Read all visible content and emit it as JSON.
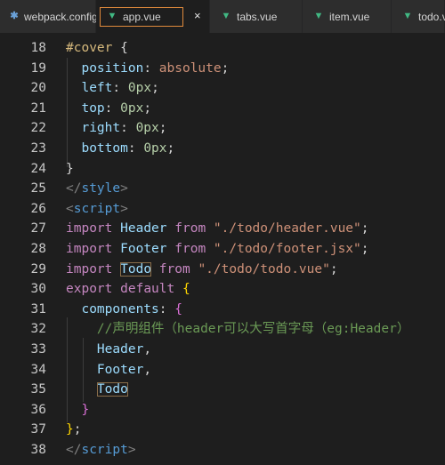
{
  "tabs": [
    {
      "label": "webpack.config.js",
      "icon": "gear-icon",
      "active": false
    },
    {
      "label": "app.vue",
      "icon": "vue-icon",
      "active": true,
      "close": "×"
    },
    {
      "label": "tabs.vue",
      "icon": "vue-icon",
      "active": false
    },
    {
      "label": "item.vue",
      "icon": "vue-icon",
      "active": false
    },
    {
      "label": "todo.vu",
      "icon": "vue-icon",
      "active": false
    }
  ],
  "icons": {
    "gear": "✱",
    "vue": "▼"
  },
  "colors": {
    "background": "#1e1e1e",
    "tab_bar": "#252526",
    "active_tab_border": "#e08a3c",
    "keyword": "#c586c0",
    "identifier": "#9cdcfe",
    "string": "#ce9178",
    "number": "#b5cea8",
    "comment": "#6a9955",
    "css_selector": "#d7ba7d",
    "tag": "#569cd6"
  },
  "editor": {
    "lines": [
      {
        "n": "18",
        "tokens": [
          {
            "t": "#cover",
            "c": "t-sel"
          },
          {
            "t": " ",
            "c": "t-plain"
          },
          {
            "t": "{",
            "c": "t-plain"
          }
        ]
      },
      {
        "n": "19",
        "tokens": [
          {
            "t": "  position",
            "c": "t-prop"
          },
          {
            "t": ": ",
            "c": "t-plain"
          },
          {
            "t": "absolute",
            "c": "t-val"
          },
          {
            "t": ";",
            "c": "t-plain"
          }
        ]
      },
      {
        "n": "20",
        "tokens": [
          {
            "t": "  left",
            "c": "t-prop"
          },
          {
            "t": ": ",
            "c": "t-plain"
          },
          {
            "t": "0px",
            "c": "t-num"
          },
          {
            "t": ";",
            "c": "t-plain"
          }
        ]
      },
      {
        "n": "21",
        "tokens": [
          {
            "t": "  top",
            "c": "t-prop"
          },
          {
            "t": ": ",
            "c": "t-plain"
          },
          {
            "t": "0px",
            "c": "t-num"
          },
          {
            "t": ";",
            "c": "t-plain"
          }
        ]
      },
      {
        "n": "22",
        "tokens": [
          {
            "t": "  right",
            "c": "t-prop"
          },
          {
            "t": ": ",
            "c": "t-plain"
          },
          {
            "t": "0px",
            "c": "t-num"
          },
          {
            "t": ";",
            "c": "t-plain"
          }
        ]
      },
      {
        "n": "23",
        "tokens": [
          {
            "t": "  bottom",
            "c": "t-prop"
          },
          {
            "t": ": ",
            "c": "t-plain"
          },
          {
            "t": "0px",
            "c": "t-num"
          },
          {
            "t": ";",
            "c": "t-plain"
          }
        ]
      },
      {
        "n": "24",
        "tokens": [
          {
            "t": "}",
            "c": "t-plain"
          }
        ]
      },
      {
        "n": "25",
        "tokens": [
          {
            "t": "</",
            "c": "t-tag"
          },
          {
            "t": "style",
            "c": "t-tagname"
          },
          {
            "t": ">",
            "c": "t-tag"
          }
        ]
      },
      {
        "n": "26",
        "tokens": [
          {
            "t": "<",
            "c": "t-tag"
          },
          {
            "t": "script",
            "c": "t-tagname"
          },
          {
            "t": ">",
            "c": "t-tag"
          }
        ]
      },
      {
        "n": "27",
        "tokens": [
          {
            "t": "import",
            "c": "t-kw"
          },
          {
            "t": " ",
            "c": "t-plain"
          },
          {
            "t": "Header",
            "c": "t-id"
          },
          {
            "t": " ",
            "c": "t-plain"
          },
          {
            "t": "from",
            "c": "t-kw"
          },
          {
            "t": " ",
            "c": "t-plain"
          },
          {
            "t": "\"./todo/header.vue\"",
            "c": "t-str"
          },
          {
            "t": ";",
            "c": "t-plain"
          }
        ]
      },
      {
        "n": "28",
        "tokens": [
          {
            "t": "import",
            "c": "t-kw"
          },
          {
            "t": " ",
            "c": "t-plain"
          },
          {
            "t": "Footer",
            "c": "t-id"
          },
          {
            "t": " ",
            "c": "t-plain"
          },
          {
            "t": "from",
            "c": "t-kw"
          },
          {
            "t": " ",
            "c": "t-plain"
          },
          {
            "t": "\"./todo/footer.jsx\"",
            "c": "t-str"
          },
          {
            "t": ";",
            "c": "t-plain"
          }
        ]
      },
      {
        "n": "29",
        "tokens": [
          {
            "t": "import",
            "c": "t-kw"
          },
          {
            "t": " ",
            "c": "t-plain"
          },
          {
            "t": "Todo",
            "c": "t-id hl"
          },
          {
            "t": " ",
            "c": "t-plain"
          },
          {
            "t": "from",
            "c": "t-kw"
          },
          {
            "t": " ",
            "c": "t-plain"
          },
          {
            "t": "\"./todo/todo.vue\"",
            "c": "t-str"
          },
          {
            "t": ";",
            "c": "t-plain"
          }
        ]
      },
      {
        "n": "30",
        "tokens": [
          {
            "t": "export",
            "c": "t-kw"
          },
          {
            "t": " ",
            "c": "t-plain"
          },
          {
            "t": "default",
            "c": "t-kw"
          },
          {
            "t": " ",
            "c": "t-plain"
          },
          {
            "t": "{",
            "c": "t-brace"
          }
        ]
      },
      {
        "n": "31",
        "tokens": [
          {
            "t": "  components",
            "c": "t-id"
          },
          {
            "t": ": ",
            "c": "t-plain"
          },
          {
            "t": "{",
            "c": "t-brace2"
          }
        ]
      },
      {
        "n": "32",
        "tokens": [
          {
            "t": "    //声明组件（header可以大写首字母（eg:Header）",
            "c": "t-cmt"
          }
        ]
      },
      {
        "n": "33",
        "tokens": [
          {
            "t": "    Header",
            "c": "t-id"
          },
          {
            "t": ",",
            "c": "t-plain"
          }
        ]
      },
      {
        "n": "34",
        "tokens": [
          {
            "t": "    Footer",
            "c": "t-id"
          },
          {
            "t": ",",
            "c": "t-plain"
          }
        ]
      },
      {
        "n": "35",
        "tokens": [
          {
            "t": "    ",
            "c": "t-plain"
          },
          {
            "t": "Todo",
            "c": "t-id hl"
          }
        ]
      },
      {
        "n": "36",
        "tokens": [
          {
            "t": "  }",
            "c": "t-brace2"
          }
        ]
      },
      {
        "n": "37",
        "tokens": [
          {
            "t": "}",
            "c": "t-brace"
          },
          {
            "t": ";",
            "c": "t-plain"
          }
        ]
      },
      {
        "n": "38",
        "tokens": [
          {
            "t": "</",
            "c": "t-tag"
          },
          {
            "t": "script",
            "c": "t-tagname"
          },
          {
            "t": ">",
            "c": "t-tag"
          }
        ]
      }
    ]
  }
}
